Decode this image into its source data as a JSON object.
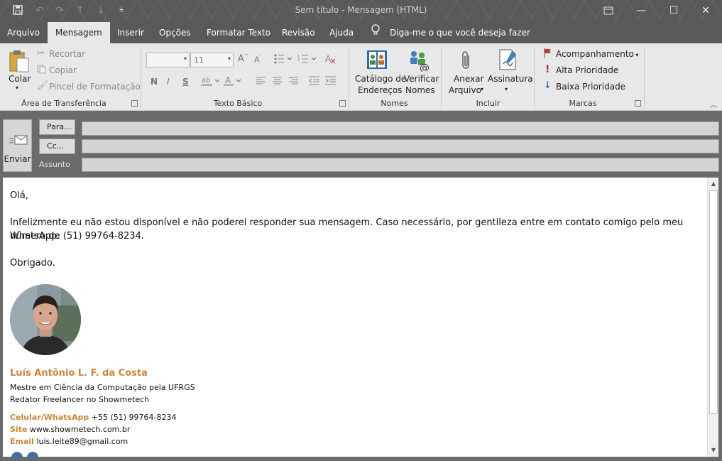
{
  "window": {
    "title": "Sem título  -  Mensagem (HTML)",
    "qat_icons": [
      "save-icon",
      "undo-icon",
      "redo-icon",
      "up-arrow-icon",
      "down-arrow-icon",
      "customize-qat-icon"
    ],
    "controls": [
      "restore-ribbon-icon",
      "minimize-icon",
      "maximize-icon",
      "close-icon"
    ]
  },
  "tabs": [
    {
      "label": "Arquivo"
    },
    {
      "label": "Mensagem",
      "active": true
    },
    {
      "label": "Inserir"
    },
    {
      "label": "Opções"
    },
    {
      "label": "Formatar Texto"
    },
    {
      "label": "Revisão"
    },
    {
      "label": "Ajuda"
    }
  ],
  "tell_me": "Diga-me o que você deseja fazer",
  "ribbon": {
    "clipboard": {
      "label": "Área de Transferência",
      "paste": "Colar",
      "cut": "Recortar",
      "copy": "Copiar",
      "format_painter": "Pincel de Formatação"
    },
    "basic_text": {
      "label": "Texto Básico",
      "font_name": "",
      "font_size": "11",
      "bold": "N",
      "italic": "I",
      "underline": "S"
    },
    "names": {
      "label": "Nomes",
      "address_book": [
        "Catálogo de",
        "Endereços"
      ],
      "check_names": [
        "Verificar",
        "Nomes"
      ]
    },
    "include": {
      "label": "Incluir",
      "attach": [
        "Anexar",
        "Arquivo"
      ],
      "signature": "Assinatura"
    },
    "tags": {
      "label": "Marcas",
      "follow_up": "Acompanhamento",
      "high": "Alta Prioridade",
      "low": "Baixa Prioridade"
    }
  },
  "header": {
    "send": "Enviar",
    "to": "Para...",
    "cc": "Cc...",
    "subject": "Assunto",
    "to_value": "",
    "cc_value": "",
    "subject_value": ""
  },
  "body": {
    "greeting": "Olá,",
    "line1": "Infelizmente eu não estou disponível e não poderei responder sua mensagem. Caso necessário, por gentileza entre em contato comigo pelo meu número de",
    "line2": "WhatsApp: (51) 99764-8234.",
    "closing": "Obrigado.",
    "signature": {
      "name": "Luís Antônio L. F. da Costa",
      "title1": "Mestre em Ciência da Computação pela UFRGS",
      "title2": "Redator Freelancer no Showmetech",
      "phone_label": "Celular/WhatsApp",
      "phone": "+55 (51) 99764-8234",
      "site_label": "Site",
      "site": "www.showmetech.com.br",
      "email_label": "Email",
      "email": "luis.leite89@gmail.com"
    }
  },
  "colors": {
    "titlebar": "#595959",
    "ribbon": "#e8e8e8",
    "signature_accent": "#c8873c"
  }
}
